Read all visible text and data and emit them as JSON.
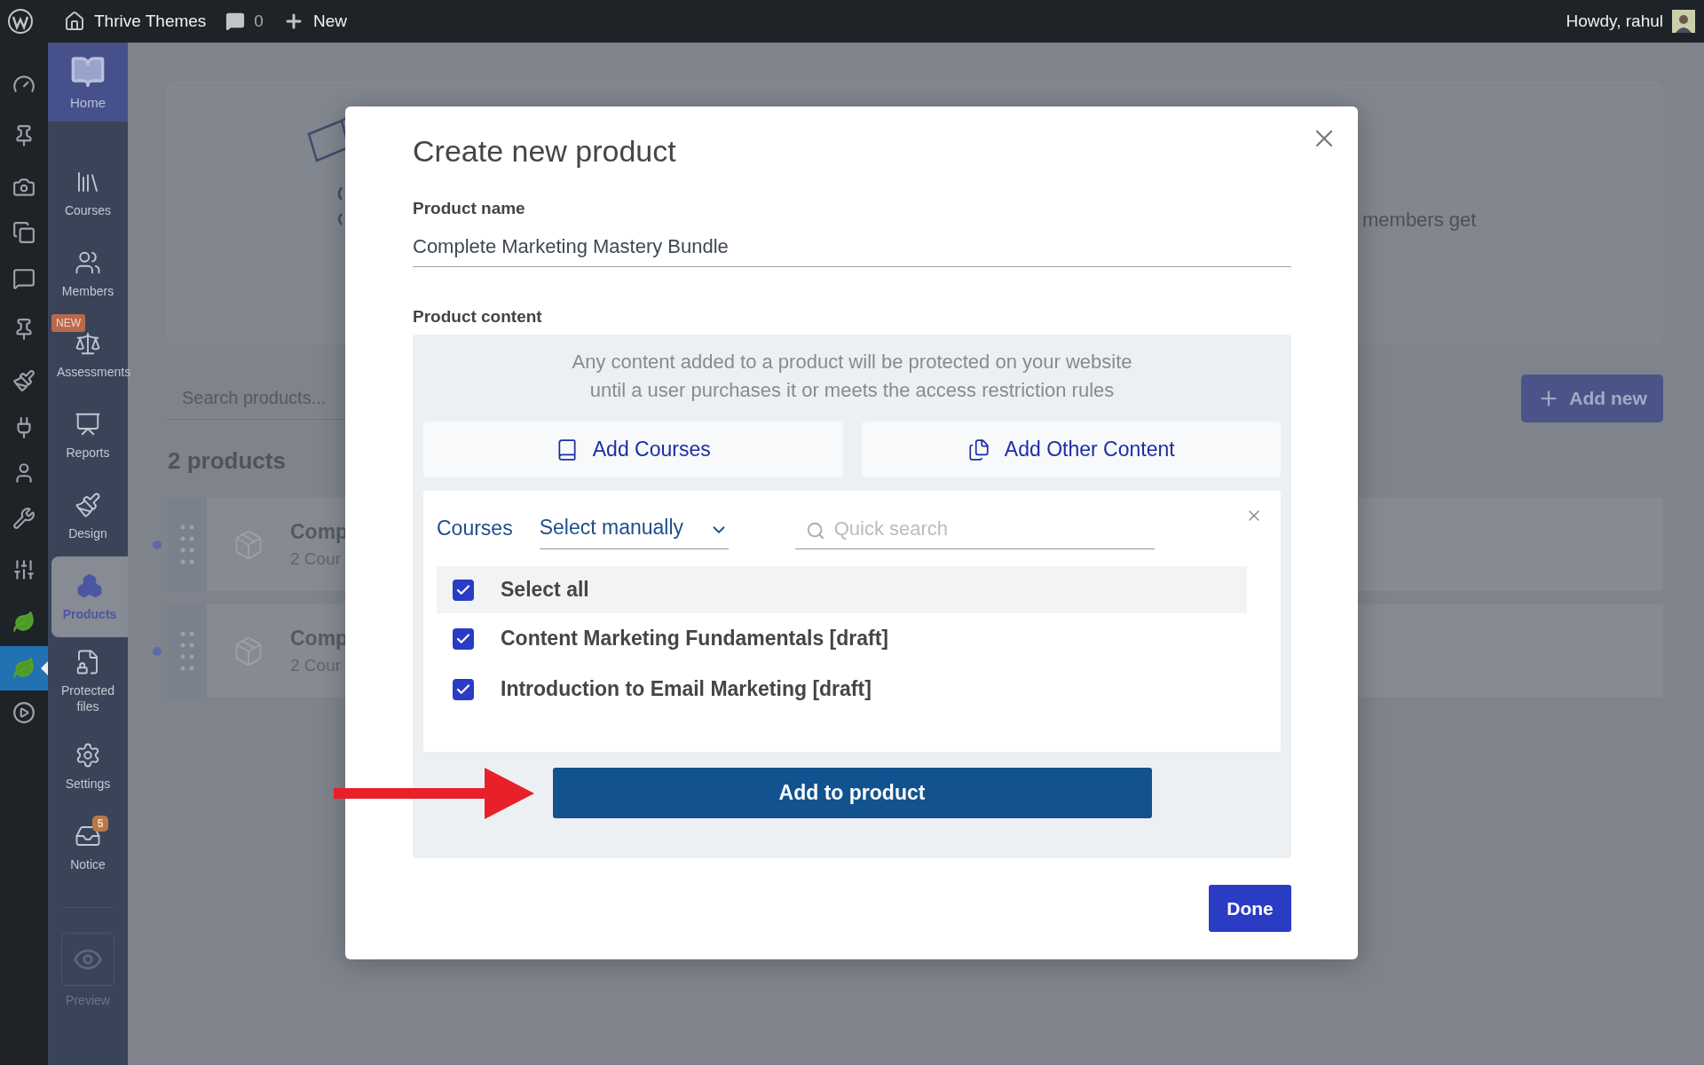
{
  "top_bar": {
    "site_name": "Thrive Themes",
    "comments_count": "0",
    "new_label": "New",
    "greeting": "Howdy, rahul"
  },
  "admin_menu": [
    {
      "selected": false
    },
    {
      "selected": false
    },
    {
      "selected": false
    },
    {
      "selected": false
    },
    {
      "selected": false
    },
    {
      "selected": false
    },
    {
      "selected": false
    },
    {
      "selected": false
    },
    {
      "selected": false
    },
    {
      "selected": false
    },
    {
      "selected": false
    },
    {
      "selected": false
    },
    {
      "selected": true
    },
    {
      "selected": false
    }
  ],
  "sidebar": {
    "home": {
      "label": "Home"
    },
    "items": [
      {
        "label": "Courses",
        "selected": false
      },
      {
        "label": "Members",
        "selected": false
      },
      {
        "label": "Assessments",
        "selected": false,
        "badge": "NEW"
      },
      {
        "label": "Reports",
        "selected": false
      },
      {
        "label": "Design",
        "selected": false
      },
      {
        "label": "Products",
        "selected": true
      },
      {
        "label": "Protected files",
        "selected": false
      },
      {
        "label": "Settings",
        "selected": false
      },
      {
        "label": "Notice",
        "selected": false,
        "count": "5"
      }
    ],
    "preview": {
      "label": "Preview",
      "disabled": true
    }
  },
  "page": {
    "hero_text": "members get",
    "search": {
      "placeholder": "Search products..."
    },
    "add_new": "Add new",
    "count": "2 products",
    "products": [
      {
        "title": "Comp",
        "subtitle": "2 Cour"
      },
      {
        "title": "Comp",
        "subtitle": "2 Cour"
      }
    ]
  },
  "modal": {
    "title": "Create new product",
    "name_label": "Product name",
    "name_value": "Complete Marketing Mastery Bundle",
    "content_label": "Product content",
    "note": "Any content added to a product will be protected on your website\nuntil a user purchases it or meets the access restriction rules",
    "add_buttons": [
      {
        "label": "Add Courses"
      },
      {
        "label": "Add Other Content"
      }
    ],
    "picker": {
      "type_label": "Courses",
      "mode": "Select manually",
      "search_placeholder": "Quick search",
      "items": [
        {
          "kind": "all",
          "label": "Select all",
          "checked": true
        },
        {
          "kind": "course",
          "label": "Content Marketing Fundamentals [draft]",
          "checked": true
        },
        {
          "kind": "course",
          "label": "Introduction to Email Marketing [draft]",
          "checked": true
        }
      ]
    },
    "add_to_product": "Add to product",
    "done": "Done"
  }
}
